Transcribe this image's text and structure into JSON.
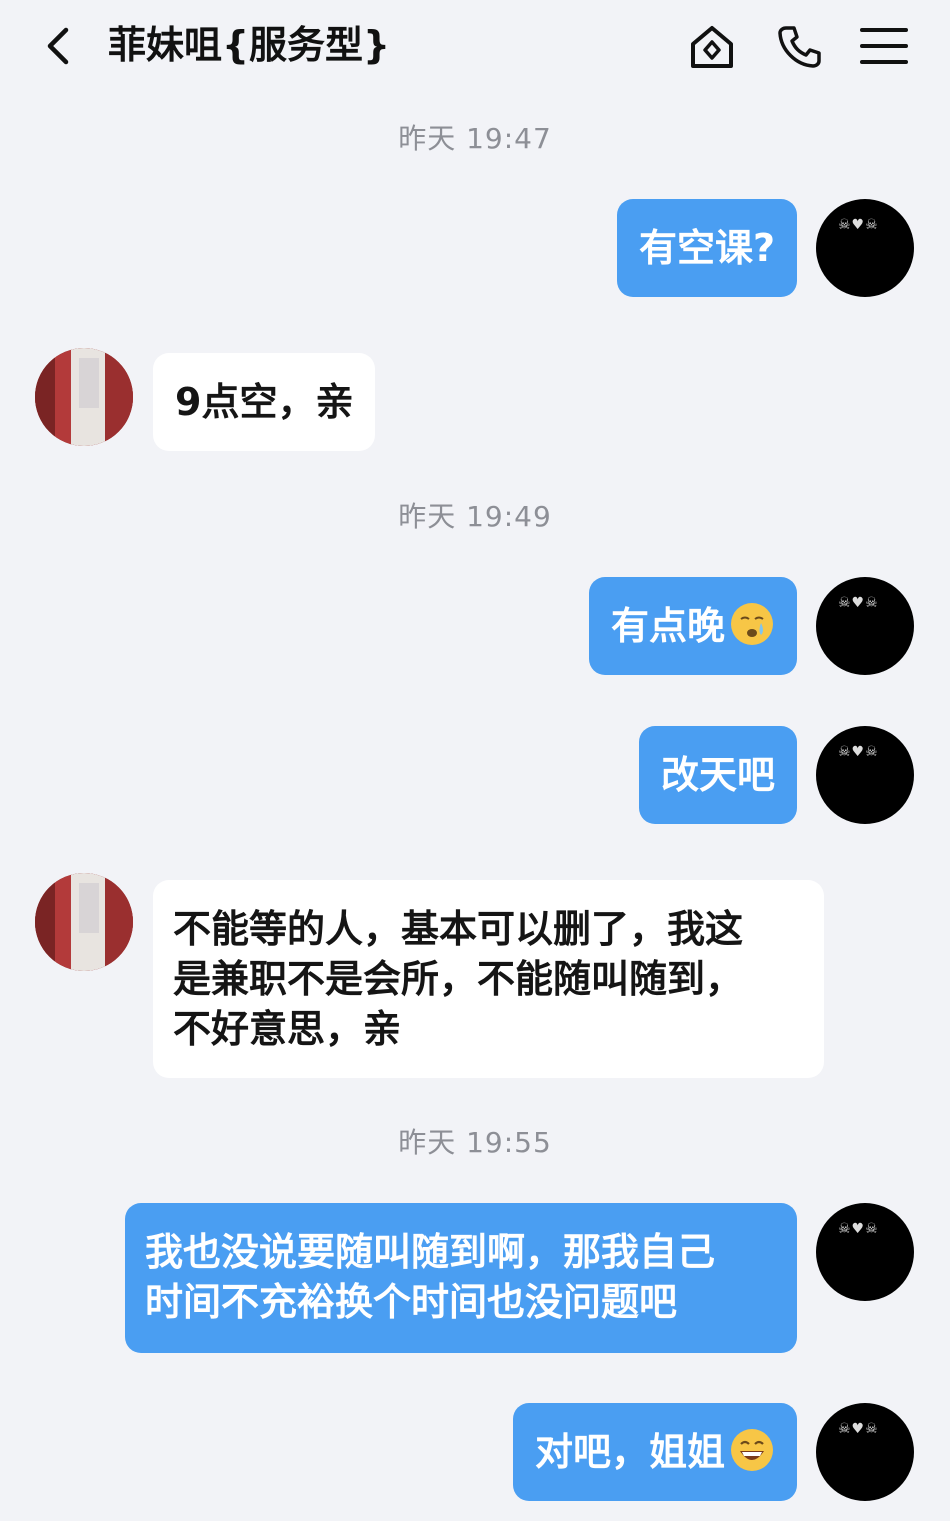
{
  "header": {
    "title": "菲妹咀{服务型}"
  },
  "icons": {
    "back": "chevron-left-icon",
    "home": "home-icon",
    "phone": "phone-icon",
    "menu": "menu-icon"
  },
  "colors": {
    "my_bubble": "#4a9ef2",
    "their_bubble": "#ffffff",
    "background": "#f2f3f7"
  },
  "messages": {
    "t1": "昨天 19:47",
    "m1": "有空课?",
    "r1": "9点空，亲",
    "t2": "昨天 19:49",
    "m2": "有点晚",
    "m3": "改天吧",
    "r2": "不能等的人，基本可以删了，我这\n是兼职不是会所，不能随叫随到，\n不好意思，亲",
    "t3": "昨天 19:55",
    "m4": "我也没说要随叫随到啊，那我自己\n时间不充裕换个时间也没问题吧",
    "m5": "对吧，姐姐"
  }
}
